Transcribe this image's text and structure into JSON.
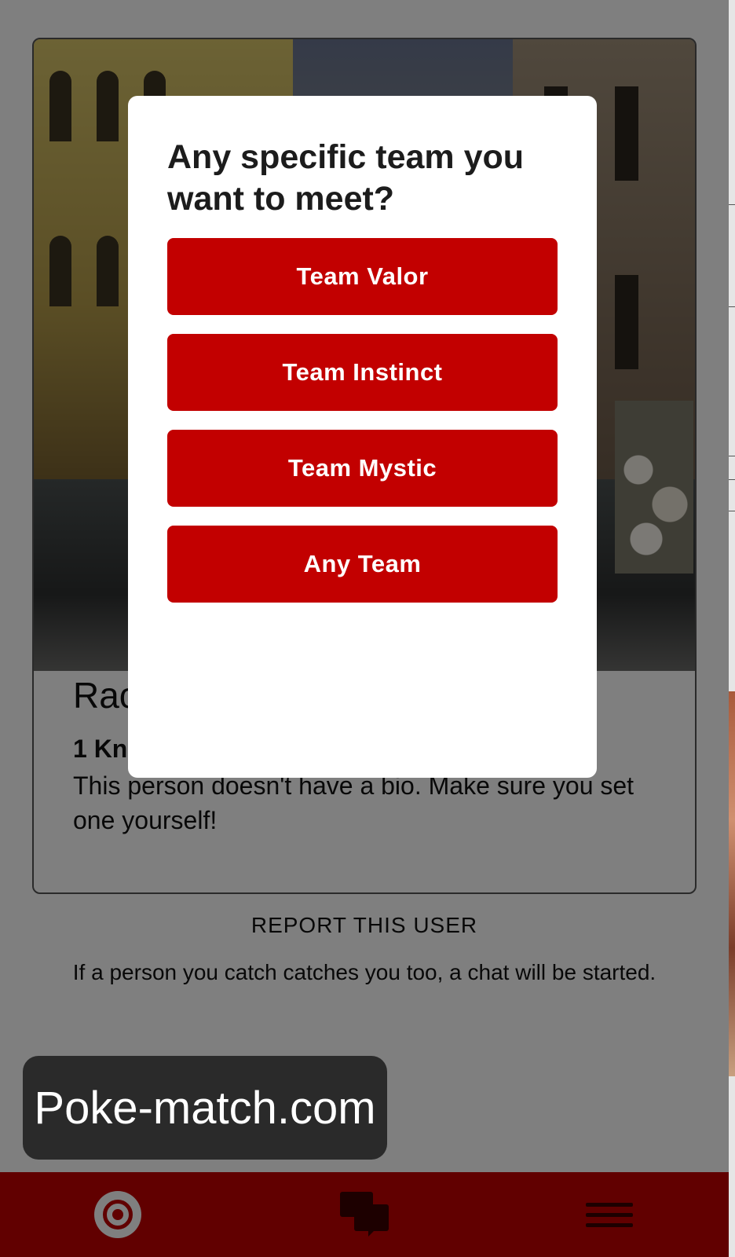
{
  "profile": {
    "name": "Rac",
    "distance": "1 Kn",
    "bio": "This person doesn't have a bio. Make sure you set one yourself!"
  },
  "report_label": "REPORT THIS USER",
  "info_text": "If a person you catch catches you too, a chat will be started.",
  "modal": {
    "title": "Any specific team you want to meet?",
    "options": [
      {
        "label": "Team Valor"
      },
      {
        "label": "Team Instinct"
      },
      {
        "label": "Team Mystic"
      },
      {
        "label": "Any Team"
      }
    ]
  },
  "tabbar": {
    "tabs": [
      {
        "icon": "target-icon",
        "selected": true
      },
      {
        "icon": "chat-bubbles-icon",
        "selected": false
      },
      {
        "icon": "menu-icon",
        "selected": false
      }
    ]
  },
  "watermark": "Poke-match.com",
  "colors": {
    "accent": "#c20000",
    "overlay": "rgba(0,0,0,0.5)",
    "watermark_bg": "#2a2a2a"
  }
}
